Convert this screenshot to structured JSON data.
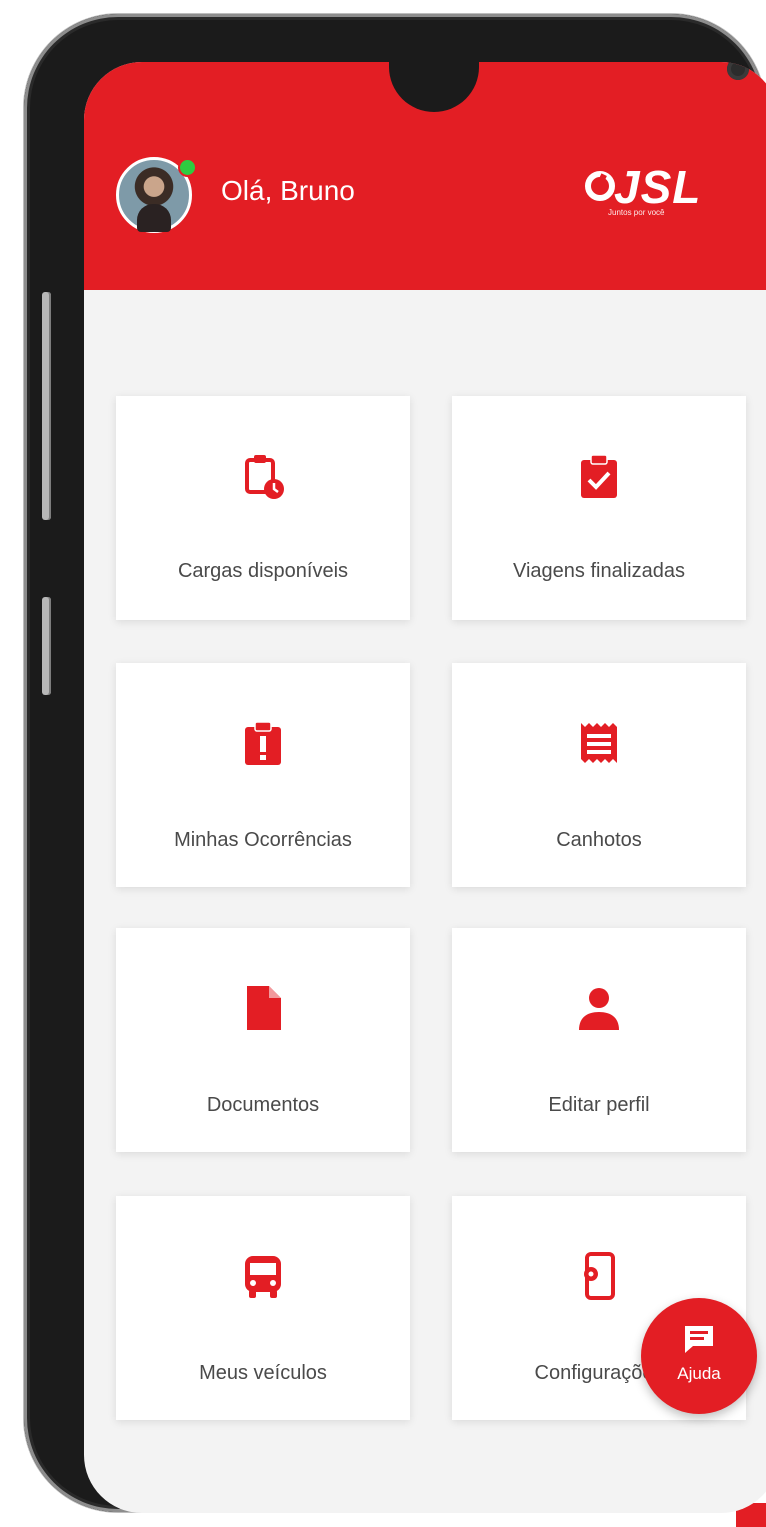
{
  "header": {
    "greeting": "Olá, Bruno",
    "logo_text": "JSL",
    "logo_tagline": "Juntos por você",
    "online_status_color": "#2ecc40"
  },
  "colors": {
    "brand_red": "#e31e24",
    "background": "#f3f3f3",
    "tile": "#ffffff",
    "label": "#4a4a4a"
  },
  "tiles": [
    {
      "label": "Cargas disponíveis",
      "icon": "clipboard-clock-icon"
    },
    {
      "label": "Viagens finalizadas",
      "icon": "clipboard-check-icon"
    },
    {
      "label": "Minhas Ocorrências",
      "icon": "clipboard-alert-icon"
    },
    {
      "label": "Canhotos",
      "icon": "receipt-icon"
    },
    {
      "label": "Documentos",
      "icon": "document-icon"
    },
    {
      "label": "Editar perfil",
      "icon": "person-icon"
    },
    {
      "label": "Meus veículos",
      "icon": "bus-icon"
    },
    {
      "label": "Configurações",
      "icon": "phone-settings-icon"
    }
  ],
  "fab": {
    "label": "Ajuda",
    "icon": "chat-icon"
  }
}
